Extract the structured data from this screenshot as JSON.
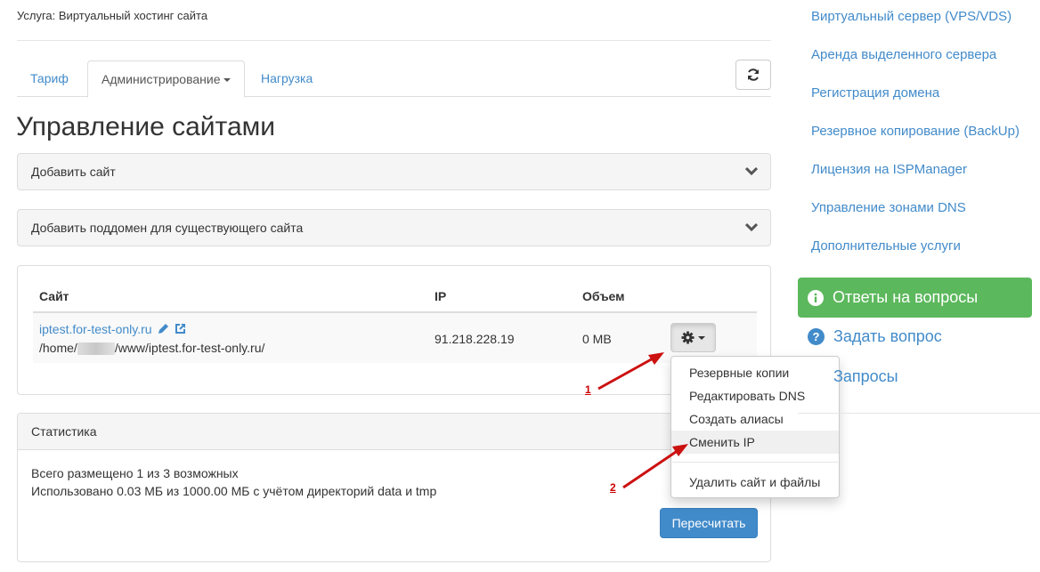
{
  "service": "Услуга: Виртуальный хостинг сайта",
  "tabs": [
    {
      "label": "Тариф"
    },
    {
      "label": "Администрирование"
    },
    {
      "label": "Нагрузка"
    }
  ],
  "page_title": "Управление сайтами",
  "accordions": {
    "add_site": "Добавить сайт",
    "add_subdomain": "Добавить поддомен для существующего сайта"
  },
  "table": {
    "headers": [
      "Сайт",
      "IP",
      "Объем"
    ],
    "rows": [
      {
        "site": "iptest.for-test-only.ru",
        "path_prefix": "/home/",
        "path_suffix": "/www/iptest.for-test-only.ru/",
        "ip": "91.218.228.19",
        "volume": "0 MB"
      }
    ]
  },
  "dropdown": {
    "items": [
      "Резервные копии",
      "Редактировать DNS",
      "Создать алиасы",
      "Сменить IP"
    ],
    "danger_item": "Удалить сайт и файлы"
  },
  "stats": {
    "title": "Статистика",
    "line1": "Всего размещено 1 из 3 возможных",
    "line2": "Использовано 0.03 МБ из 1000.00 МБ с учётом директорий data и tmp",
    "recalc_label": "Пересчитать"
  },
  "sidebar": {
    "links": [
      "Виртуальный сервер (VPS/VDS)",
      "Аренда выделенного сервера",
      "Регистрация домена",
      "Резервное копирование (BackUp)",
      "Лицензия на ISPManager",
      "Управление зонами DNS",
      "Дополнительные услуги"
    ],
    "faq_label": "Ответы на вопросы",
    "ask_label": "Задать вопрос",
    "requests_label": "Запросы"
  },
  "annotations": {
    "step1": "1",
    "step2": "2"
  },
  "colors": {
    "link": "#428bca",
    "success": "#5cb85c",
    "primary": "#428bca",
    "arrow": "#cc1111"
  },
  "icons": [
    "refresh-icon",
    "chevron-down-icon",
    "pencil-icon",
    "external-link-icon",
    "gear-icon",
    "info-circle-icon",
    "question-circle-icon"
  ]
}
